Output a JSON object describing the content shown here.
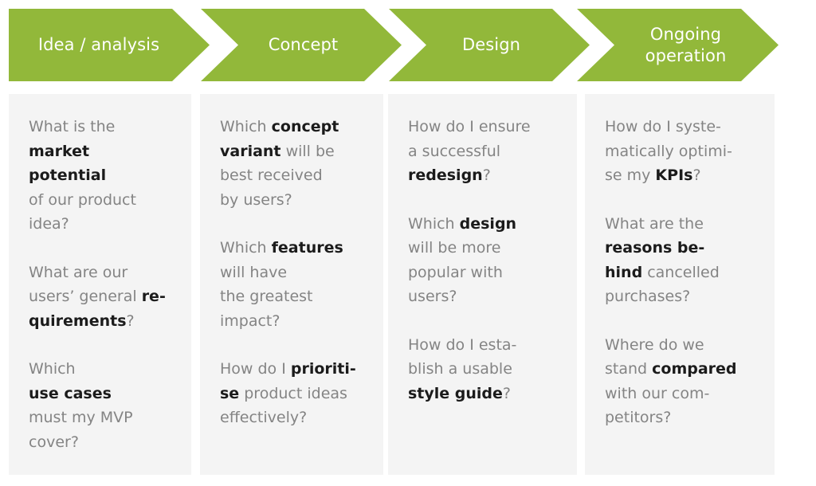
{
  "theme": {
    "arrow_green": "#92b83a",
    "panel_background": "#f4f4f4",
    "body_text": "#848484",
    "highlight_text": "#1b1b1b",
    "page_background": "#ffffff"
  },
  "phases": [
    {
      "label": "Idea / analysis"
    },
    {
      "label": "Concept"
    },
    {
      "label": "Design"
    },
    {
      "label": "Ongoing\noperation"
    }
  ],
  "columns": [
    {
      "questions": [
        [
          {
            "t": "What is the\n",
            "b": false
          },
          {
            "t": "market\npotential\n",
            "b": true
          },
          {
            "t": "of our product\nidea?",
            "b": false
          }
        ],
        [
          {
            "t": "What are our\nusers’ general ",
            "b": false
          },
          {
            "t": "re-\nquirements",
            "b": true
          },
          {
            "t": "?",
            "b": false
          }
        ],
        [
          {
            "t": "Which\n",
            "b": false
          },
          {
            "t": "use cases",
            "b": true
          },
          {
            "t": "\n must my MVP\ncover?",
            "b": false
          }
        ]
      ]
    },
    {
      "questions": [
        [
          {
            "t": "Which ",
            "b": false
          },
          {
            "t": "concept\nvariant",
            "b": true
          },
          {
            "t": " will be\nbest received\nby users?",
            "b": false
          }
        ],
        [
          {
            "t": "Which ",
            "b": false
          },
          {
            "t": "features",
            "b": true
          },
          {
            "t": "\nwill have\nthe greatest\nimpact?",
            "b": false
          }
        ],
        [
          {
            "t": "How do I ",
            "b": false
          },
          {
            "t": "prioriti-\nse",
            "b": true
          },
          {
            "t": " product ideas\neffectively?",
            "b": false
          }
        ]
      ]
    },
    {
      "questions": [
        [
          {
            "t": "How do I ensure\na successful\n",
            "b": false
          },
          {
            "t": "redesign",
            "b": true
          },
          {
            "t": "?",
            "b": false
          }
        ],
        [
          {
            "t": "Which ",
            "b": false
          },
          {
            "t": "design",
            "b": true
          },
          {
            "t": "\nwill be more\npopular with\nusers?",
            "b": false
          }
        ],
        [
          {
            "t": "How do I esta-\nblish a usable\n",
            "b": false
          },
          {
            "t": "style guide",
            "b": true
          },
          {
            "t": "?",
            "b": false
          }
        ]
      ]
    },
    {
      "questions": [
        [
          {
            "t": "How do I syste-\nmatically optimi-\nse my ",
            "b": false
          },
          {
            "t": "KPIs",
            "b": true
          },
          {
            "t": "?",
            "b": false
          }
        ],
        [
          {
            "t": "What are the\n",
            "b": false
          },
          {
            "t": "reasons be-\nhind",
            "b": true
          },
          {
            "t": " cancelled\npurchases?",
            "b": false
          }
        ],
        [
          {
            "t": "Where do we\nstand ",
            "b": false
          },
          {
            "t": "compared",
            "b": true
          },
          {
            "t": "\nwith our com-\npetitors?",
            "b": false
          }
        ]
      ]
    }
  ]
}
